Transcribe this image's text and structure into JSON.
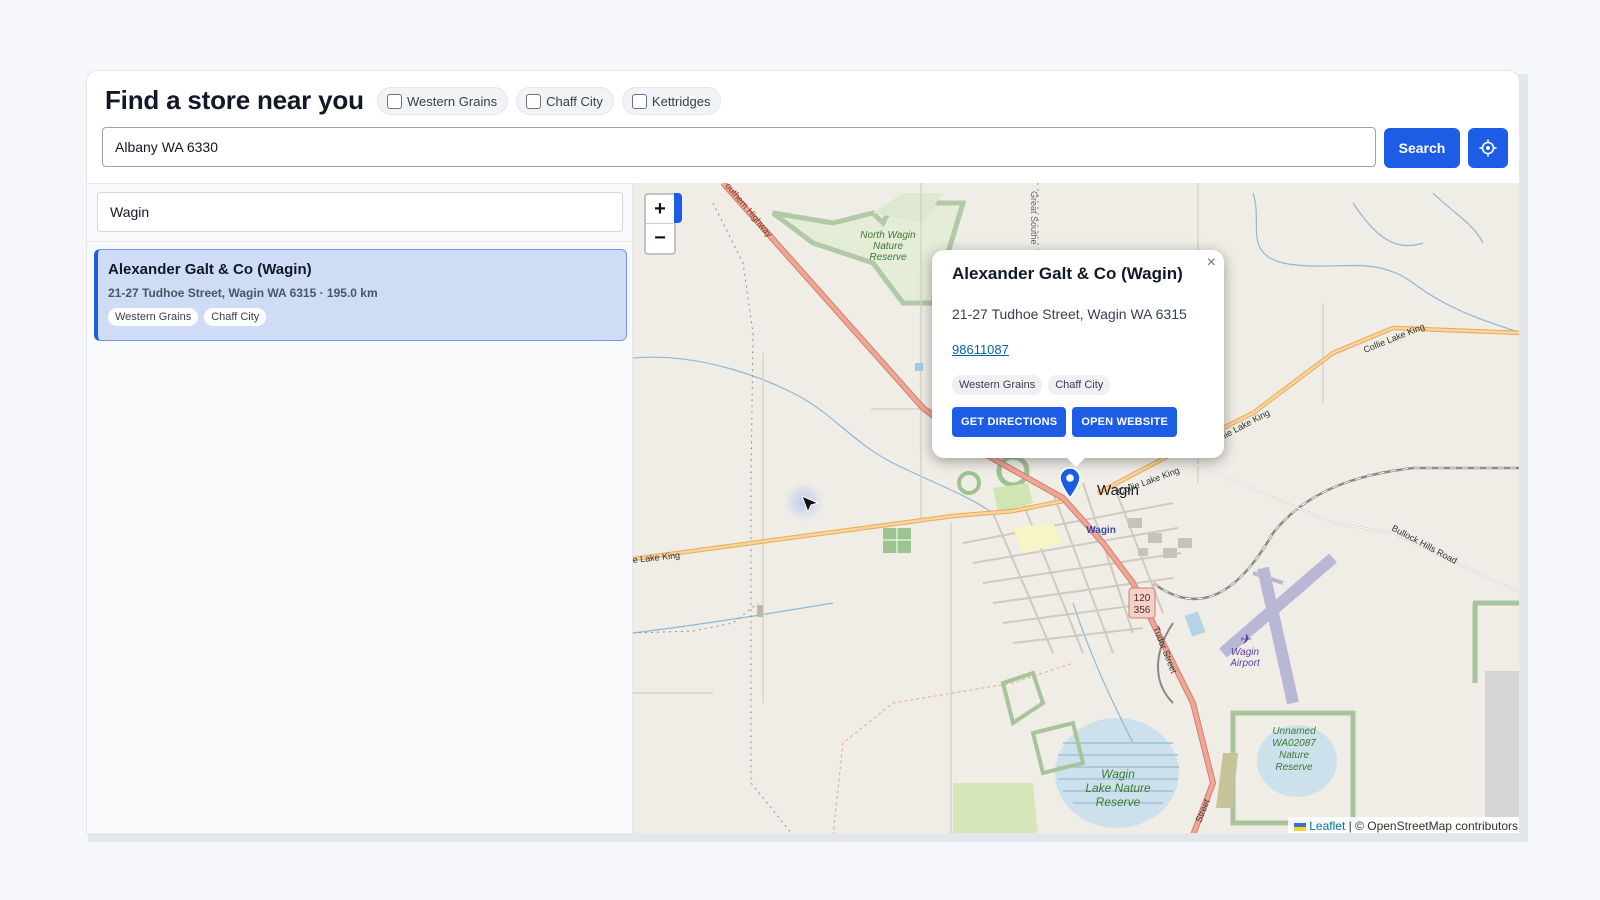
{
  "header": {
    "title": "Find a store near you",
    "filters": [
      {
        "label": "Western Grains",
        "checked": false
      },
      {
        "label": "Chaff City",
        "checked": false
      },
      {
        "label": "Kettridges",
        "checked": false
      }
    ],
    "address_value": "Albany WA 6330",
    "search_label": "Search",
    "locate_icon": "crosshair-icon"
  },
  "sidebar": {
    "filter_value": "Wagin",
    "results": [
      {
        "name": "Alexander Galt & Co (Wagin)",
        "meta": "21-27 Tudhoe Street, Wagin WA 6315 · 195.0 km",
        "tags": [
          "Western Grains",
          "Chaff City"
        ],
        "selected": true
      }
    ]
  },
  "map": {
    "zoom_in": "+",
    "zoom_out": "−",
    "popup": {
      "close": "×",
      "name": "Alexander Galt & Co (Wagin)",
      "address": "21-27 Tudhoe Street, Wagin WA 6315",
      "phone": "98611087",
      "tags": [
        "Western Grains",
        "Chaff City"
      ],
      "directions_label": "GET DIRECTIONS",
      "website_label": "OPEN WEBSITE"
    },
    "labels": {
      "north_reserve_1": "North Wagin",
      "north_reserve_2": "Nature",
      "north_reserve_3": "Reserve",
      "town": "Wagin",
      "town_small": "Wagin",
      "collie_lake_1": "Collie Lake King",
      "collie_lake_2": "Collie Lake King",
      "collie_lake_3": "Collie Lake King",
      "lake_king_west": "e Lake King",
      "bullock_hills": "Bullock Hills Road",
      "tudor_street": "Tudor Street",
      "tudor_street_2": "Street",
      "airport_1": "Wagin",
      "airport_2": "Airport",
      "lake_reserve_1": "Wagin",
      "lake_reserve_2": "Lake Nature",
      "lake_reserve_3": "Reserve",
      "unnamed_1": "Unnamed",
      "unnamed_2": "WA02087",
      "unnamed_3": "Nature",
      "unnamed_4": "Reserve",
      "great_southern": "Great Southe",
      "highway_nw": "outhern Highway",
      "road_shield_1": "120",
      "road_shield_2": "356"
    },
    "attribution": {
      "leaflet": "Leaflet",
      "osm": "| © OpenStreetMap contributors"
    },
    "accent_color": "#1d5ce5"
  }
}
